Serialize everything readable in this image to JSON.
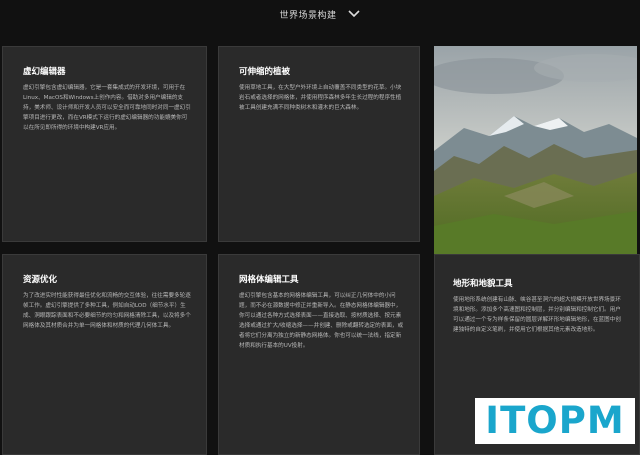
{
  "header": {
    "title": "世界场景构建",
    "toggle_icon": "chevron-down-icon"
  },
  "cards": [
    {
      "title": "虚幻编辑器",
      "body": "虚幻引擎包含虚幻编辑器，它是一套集成式的开发环境，可用于在Linux、MacOS和Windows上创作内容。借助对多用户编辑的支持，美术师、设计师和开发人员可以安全而可靠地同时对同一虚幻引擎项目进行更改，而在VR模式下运行的虚幻编辑器的功能媲美你可以在所见即所得的环境中构建VR应用。"
    },
    {
      "title": "可伸缩的植被",
      "body": "使用草地工具，在大型户外环境上自动覆盖不同类型的花草。小块岩石或者选择的网格体，并使用程序森林多年生长过程的程序性植被工具创建充满不同种类树木和灌木的巨大森林。"
    },
    {
      "title": "资源优化",
      "body": "为了改进实时性能获得最佳优化和流畅的交互体验，往往需要多轮逐帧工作。虚幻引擎提供了多种工具，例如自动LOD（细节水平）生成、洞眼跟踪表面和不必要细节的均匀和网格清除工具，以及将多个网格体及其材质合并为单一网格体和材质的代理几何体工具。"
    },
    {
      "title": "网格体编辑工具",
      "body": "虚幻引擎包含基本的网格体编辑工具，可以纠正几何体中的小问题，而不必在源数据中修正并重新导入。在静态网格体编辑器中，你可以通过各种方式选择表面——直接选取、按材质选择、按元素选择或通过扩大/收缩选择——并创建、删除或翻转选定的表面，或者将它们分离为独立的新静态网格体。你也可以统一法线，指定新材质和执行基本的UV投射。"
    },
    {
      "title": "地形和地貌工具",
      "body": "使用地形系统创建有山脉、峡谷甚至洞穴的超大规模开放世界场景环境和地形。添加多个高速图和控制层，并分别编辑和控制它们。用户可以通过一个专为样条保留的圆层详解环形地编辑地形，在蓝图中创建独特的自定义笔刷，并使用它们根据其他元素改造地形。"
    }
  ],
  "photo": {
    "label": "mountain-landscape-image"
  },
  "watermark": {
    "text": "ITOPM",
    "color": "#1aa6cc"
  }
}
